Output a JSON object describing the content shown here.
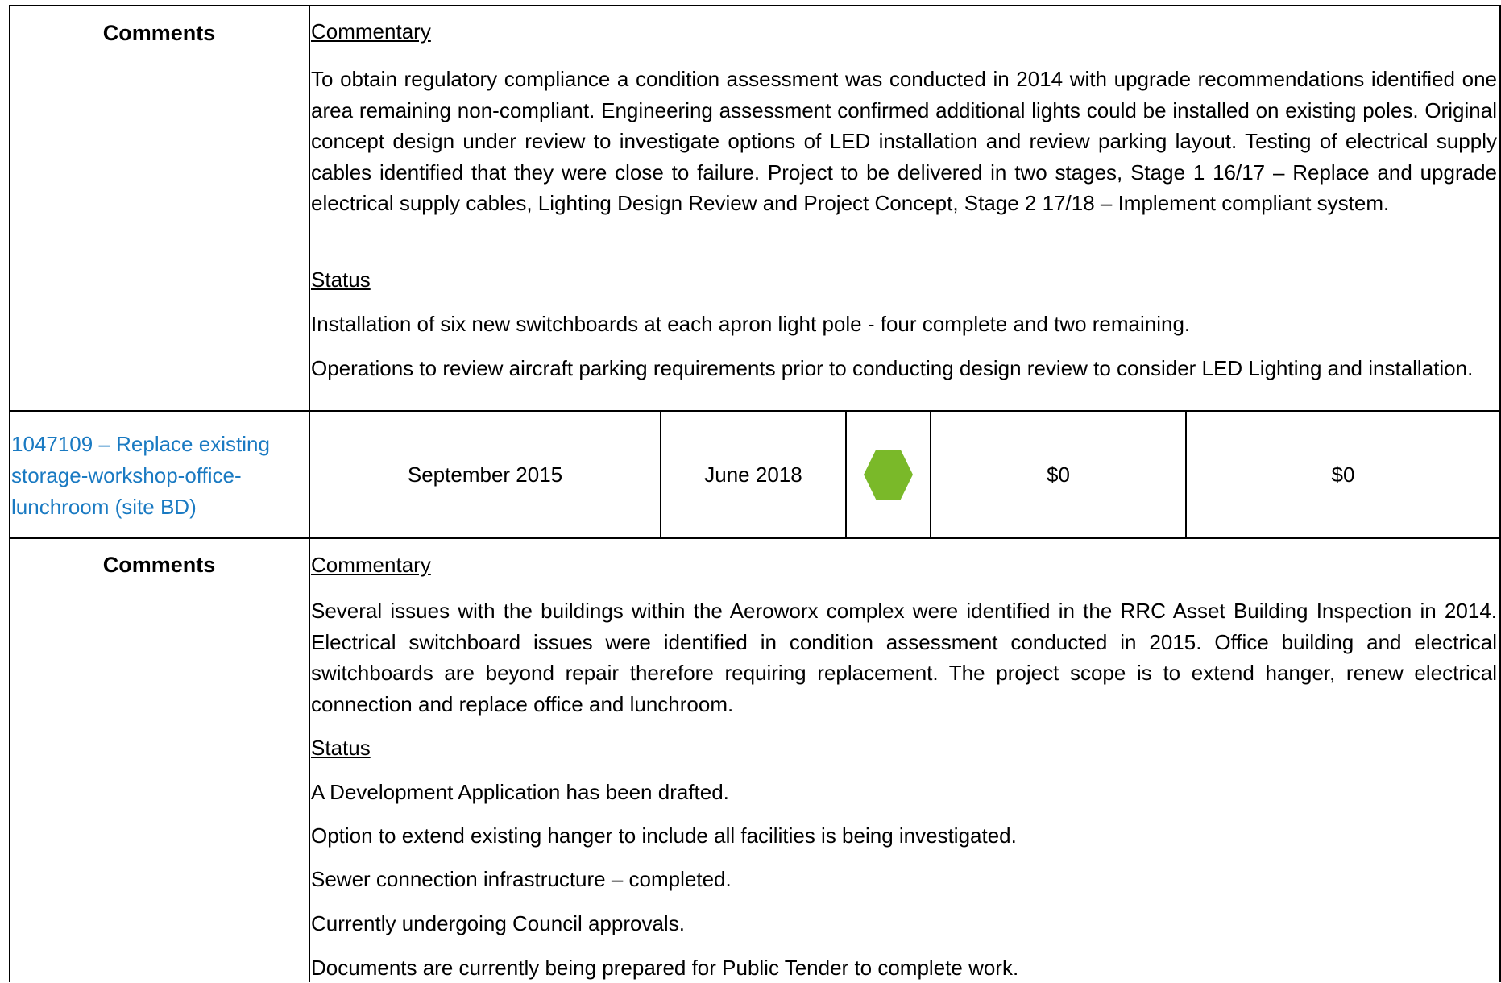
{
  "section1": {
    "label": "Comments",
    "commentary_heading": "Commentary",
    "commentary_text": "To obtain regulatory compliance a condition assessment was conducted in 2014 with upgrade recommendations identified one area remaining non-compliant.  Engineering assessment confirmed additional lights could be installed on existing poles.  Original concept design under review to investigate options of LED installation and review parking layout. Testing of electrical supply cables identified that they were close to failure.  Project to be delivered in two stages, Stage 1 16/17 – Replace and upgrade electrical supply cables, Lighting Design Review and Project Concept, Stage 2 17/18 – Implement compliant system.",
    "status_heading": "Status",
    "status_items": [
      "Installation of six new switchboards at each apron light pole - four complete and two remaining.",
      "Operations to review aircraft parking requirements prior to conducting design review to consider LED Lighting and installation."
    ]
  },
  "project_row": {
    "title": "1047109 – Replace existing storage-workshop-office-lunchroom (site BD)",
    "start": "September 2015",
    "end": "June 2018",
    "status_color": "#7ab929",
    "status_icon": "green-hexagon-icon",
    "amount1": "$0",
    "amount2": "$0"
  },
  "section2": {
    "label": "Comments",
    "commentary_heading": "Commentary",
    "commentary_text": "Several issues with the buildings within the Aeroworx complex were identified in the RRC Asset Building Inspection in 2014.  Electrical switchboard issues were identified in condition assessment conducted in 2015. Office building and electrical switchboards are beyond repair therefore requiring replacement.  The project scope is to extend hanger, renew electrical connection and replace office and lunchroom.",
    "status_heading": "Status",
    "status_items": [
      "A Development Application has been drafted.",
      "Option to extend existing hanger to include all facilities is being investigated.",
      "Sewer connection infrastructure – completed.",
      "Currently undergoing Council approvals.",
      "Documents are currently being prepared for Public Tender to complete work."
    ]
  }
}
